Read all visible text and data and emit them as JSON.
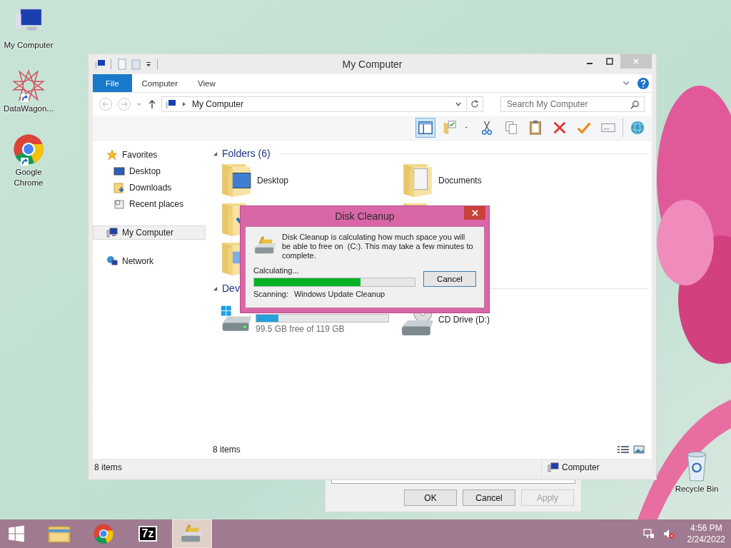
{
  "desktop_icons": [
    {
      "label": "My Computer",
      "kind": "computer",
      "shortcut": false
    },
    {
      "label": "DataWagon...",
      "kind": "star",
      "shortcut": true
    },
    {
      "label": "Google Chrome",
      "kind": "chrome",
      "shortcut": true
    }
  ],
  "recycle_bin": {
    "label": "Recycle Bin"
  },
  "explorer": {
    "title": "My Computer",
    "tabs": [
      {
        "label": "File",
        "selected": true
      },
      {
        "label": "Computer",
        "selected": false
      },
      {
        "label": "View",
        "selected": false
      }
    ],
    "address": "My Computer",
    "search": {
      "placeholder": "Search My Computer"
    },
    "toolbar": [
      {
        "kind": "pane",
        "on": true
      },
      {
        "kind": "folder",
        "on": false
      },
      {
        "kind": "caret",
        "on": false
      },
      {
        "kind": "cut",
        "on": false
      },
      {
        "kind": "copy",
        "on": false
      },
      {
        "kind": "paste",
        "on": false
      },
      {
        "kind": "delete",
        "on": false
      },
      {
        "kind": "check",
        "on": false
      },
      {
        "kind": "rename",
        "on": false
      },
      {
        "kind": "globe",
        "on": false
      }
    ],
    "nav": [
      {
        "label": "Favorites",
        "kind": "star",
        "selected": false,
        "children": [
          {
            "label": "Desktop",
            "kind": "desktop",
            "selected": false
          },
          {
            "label": "Downloads",
            "kind": "downloads",
            "selected": false
          },
          {
            "label": "Recent places",
            "kind": "recent",
            "selected": false
          }
        ]
      },
      {
        "label": "My Computer",
        "kind": "computer",
        "selected": true
      },
      {
        "label": "Network",
        "kind": "network",
        "selected": false
      }
    ],
    "folders_header": "Folders (6)",
    "folders": [
      {
        "label": "Desktop",
        "kind": "desktop"
      },
      {
        "label": "Documents",
        "kind": "documents"
      },
      {
        "kind": "downloads"
      },
      {
        "kind": "music"
      },
      {
        "kind": "pictures"
      }
    ],
    "devices_header": "Dev",
    "drives": [
      {
        "kind": "hdd",
        "level": 0.17,
        "free": "99.5 GB free of 119 GB"
      },
      {
        "kind": "cd",
        "label": "CD Drive (D:)"
      }
    ],
    "footer": "8 items",
    "status": {
      "count": "8 items",
      "location": "Computer"
    }
  },
  "properties_dialog": {
    "buttons": [
      {
        "label": "OK",
        "disabled": false
      },
      {
        "label": "Cancel",
        "disabled": false
      },
      {
        "label": "Apply",
        "disabled": true
      }
    ]
  },
  "disk_cleanup": {
    "title": "Disk Cleanup",
    "message": "Disk Cleanup is calculating how much space you will be able to free on  (C:). This may take a few minutes to complete.",
    "status": "Calculating...",
    "level": 0.66,
    "scanning_label": "Scanning:",
    "scanning_item": "Windows Update Cleanup",
    "button": "Cancel"
  },
  "taskbar": {
    "apps": [
      {
        "kind": "explorer",
        "active": false
      },
      {
        "kind": "chrome",
        "active": false
      },
      {
        "kind": "archiver",
        "icon_text": "7z",
        "active": false
      },
      {
        "kind": "cleanup",
        "active": true
      }
    ],
    "time": "4:56 PM",
    "date": "2/24/2022"
  }
}
